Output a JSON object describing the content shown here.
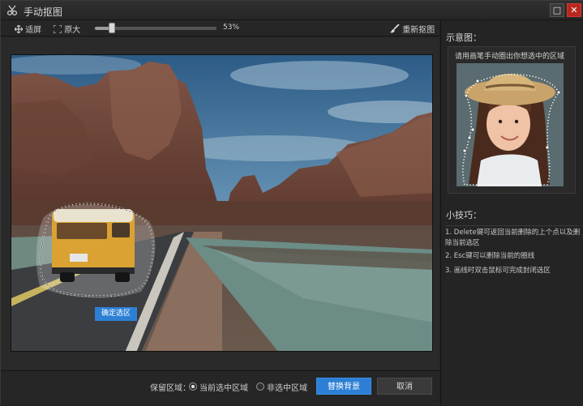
{
  "window": {
    "title": "手动抠图",
    "maximize_glyph": "□",
    "close_glyph": "✕"
  },
  "toolbar": {
    "fit_screen_label": "适屏",
    "original_size_label": "原大",
    "zoom_value": "53%",
    "zoom_fraction": 0.53,
    "redraw_label": "重新抠图"
  },
  "canvas": {
    "confirm_selection_label": "确定选区"
  },
  "bottom": {
    "keep_area_label": "保留区域：",
    "options": [
      {
        "label": "当前选中区域",
        "selected": true
      },
      {
        "label": "非选中区域",
        "selected": false
      }
    ],
    "replace_background_label": "替换背景",
    "cancel_label": "取消"
  },
  "side": {
    "demo_heading": "示意图：",
    "demo_caption": "请用画笔手动圈出你想选中的区域",
    "tips_heading": "小技巧：",
    "tips": [
      "1. Delete键可返回当前删除的上个点以及删除当前选区",
      "2. Esc键可以删除当前的圈线",
      "3. 画线时双击鼠标可完成封闭选区"
    ]
  },
  "colors": {
    "accent": "#2d7fd6",
    "close": "#b8281f",
    "background": "#232323"
  },
  "icons": {
    "app": "scissors-icon",
    "fit": "fit-screen-icon",
    "original": "original-size-icon",
    "redraw": "brush-icon"
  }
}
